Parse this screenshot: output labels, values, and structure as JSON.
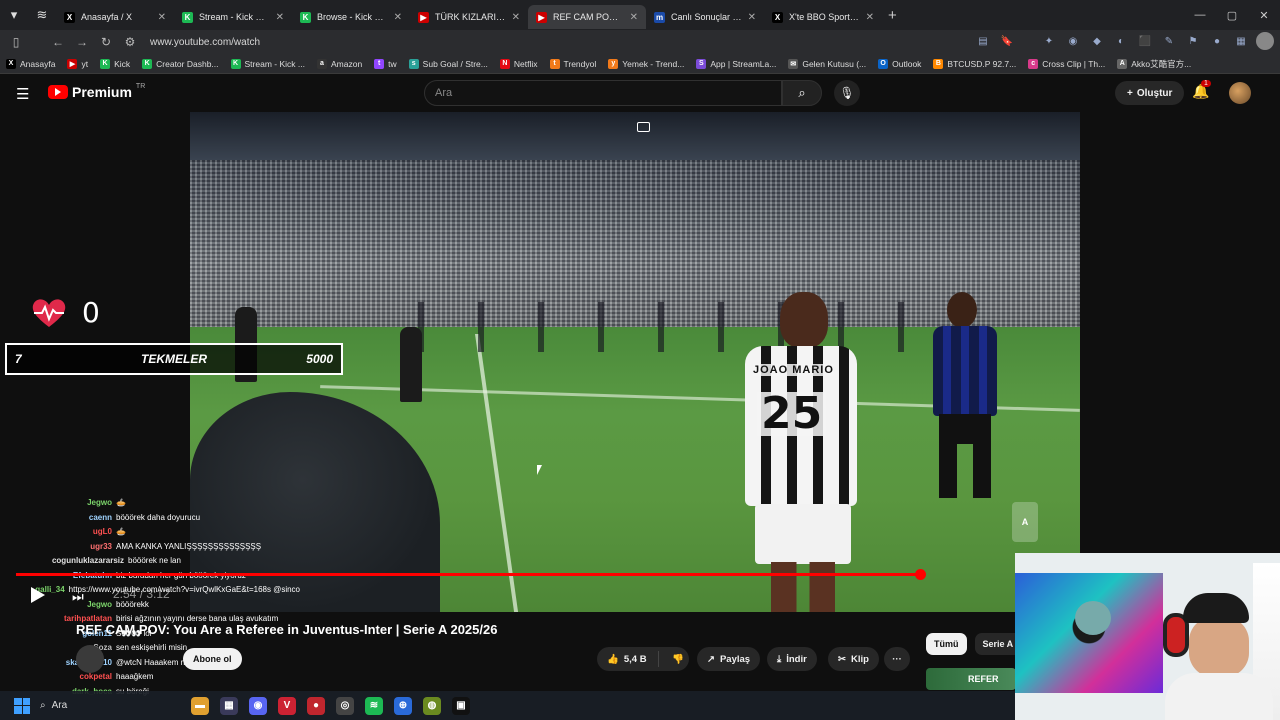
{
  "browser": {
    "tabs": [
      {
        "title": "Anasayfa / X",
        "fav": "X",
        "color": "#000000"
      },
      {
        "title": "Stream - Kick Dashboard",
        "fav": "K",
        "color": "#1db954"
      },
      {
        "title": "Browse - Kick Streaming",
        "fav": "K",
        "color": "#1db954"
      },
      {
        "title": "TÜRK KIZLARI KEKO MU SE",
        "fav": "▶",
        "color": "#cc0000"
      },
      {
        "title": "REF CAM POV: You Are a Re",
        "fav": "▶",
        "color": "#cc0000"
      },
      {
        "title": "Canlı Sonuçlar - İddaa Son",
        "fav": "m",
        "color": "#1a4aa8"
      },
      {
        "title": "X'te BBO Sports: \"Fenerbah",
        "fav": "X",
        "color": "#000000"
      }
    ],
    "url": "www.youtube.com/watch"
  },
  "bookmarks": [
    {
      "label": "Anasayfa",
      "fav": "X",
      "color": "#000000"
    },
    {
      "label": "yt",
      "fav": "▶",
      "color": "#cc0000"
    },
    {
      "label": "Kick",
      "fav": "K",
      "color": "#1db954"
    },
    {
      "label": "Creator Dashb...",
      "fav": "K",
      "color": "#1db954"
    },
    {
      "label": "Stream - Kick ...",
      "fav": "K",
      "color": "#1db954"
    },
    {
      "label": "Amazon",
      "fav": "a",
      "color": "#333333"
    },
    {
      "label": "tw",
      "fav": "t",
      "color": "#9146ff"
    },
    {
      "label": "Sub Goal / Stre...",
      "fav": "s",
      "color": "#2aa198"
    },
    {
      "label": "Netflix",
      "fav": "N",
      "color": "#e50914"
    },
    {
      "label": "Trendyol",
      "fav": "t",
      "color": "#f27a1a"
    },
    {
      "label": "Yemek - Trend...",
      "fav": "y",
      "color": "#f27a1a"
    },
    {
      "label": "App | StreamLa...",
      "fav": "S",
      "color": "#7b4bd8"
    },
    {
      "label": "Gelen Kutusu (...",
      "fav": "✉",
      "color": "#555555"
    },
    {
      "label": "Outlook",
      "fav": "O",
      "color": "#0a64c8"
    },
    {
      "label": "BTCUSD.P 92.7...",
      "fav": "B",
      "color": "#ff8800"
    },
    {
      "label": "Cross Clip | Th...",
      "fav": "c",
      "color": "#d83a8a"
    },
    {
      "label": "Akko艾酷官方...",
      "fav": "A",
      "color": "#666666"
    }
  ],
  "youtube": {
    "logo": "Premium",
    "region": "TR",
    "search_placeholder": "Ara",
    "create_label": "Oluştur",
    "notif_count": "1"
  },
  "overlay": {
    "heart_count": "0",
    "kick_left": "7",
    "kick_label": "TEKMELER",
    "kick_goal": "5000"
  },
  "player": {
    "timecode": "2:54 / 3:12",
    "progress_fraction": 0.906,
    "video_jersey_name": "JOAO MARIO",
    "video_jersey_number": "25"
  },
  "chat": [
    {
      "user": "Jegwo",
      "text": "🥧",
      "color": "#7bd36a"
    },
    {
      "user": "caenn",
      "text": "bööörek daha doyurucu",
      "color": "#9fd3ff"
    },
    {
      "user": "ugL0",
      "text": "🥧",
      "color": "#ff5050"
    },
    {
      "user": "ugr33",
      "text": "AMA KANKA YANLIŞŞŞŞŞŞŞŞŞŞŞŞŞŞ",
      "color": "#ff7070"
    },
    {
      "user": "cogunluklazararsiz",
      "text": "bööörek ne lan",
      "color": "#e0e0e0"
    },
    {
      "user": "Efebatuhn",
      "text": "biz buradan her gün bööörek yiyoruz",
      "color": "#9fd3ff"
    },
    {
      "user": "galli_34",
      "text": "https://www.youtube.com/watch?v=ivrQwlKxGaE&t=168s @sinco",
      "color": "#7bd36a"
    },
    {
      "user": "Jegwo",
      "text": "bööörekk",
      "color": "#7bd36a"
    },
    {
      "user": "tarihpatlatan",
      "text": "birisi ağzının yayını derse bana ulaş avukatım",
      "color": "#ff5050"
    },
    {
      "user": "golen11",
      "text": "S👀👀 lol",
      "color": "#9fd3ff"
    },
    {
      "user": "Soza",
      "text": "sen eskişehirli misin",
      "color": "#c0c0c0"
    },
    {
      "user": "skadoosh10",
      "text": "@wtcN Haaakem ne 🥧",
      "color": "#9fd3ff"
    },
    {
      "user": "cokpetal",
      "text": "haaağkem",
      "color": "#ff5050"
    },
    {
      "user": "dark_hoca",
      "text": "su böreği",
      "color": "#7bd36a"
    }
  ],
  "video_info": {
    "title": "REF CAM POV: You Are a Referee in Juventus-Inter | Serie A 2025/26",
    "subscribe": "Abone ol",
    "likes": "5,4 B",
    "share": "Paylaş",
    "download": "İndir",
    "clip": "Klip",
    "more": "···"
  },
  "sidebar_chips": [
    "Tümü",
    "Serie A a"
  ],
  "next_thumb_text": "REFER",
  "taskbar": {
    "search_placeholder": "Ara"
  }
}
